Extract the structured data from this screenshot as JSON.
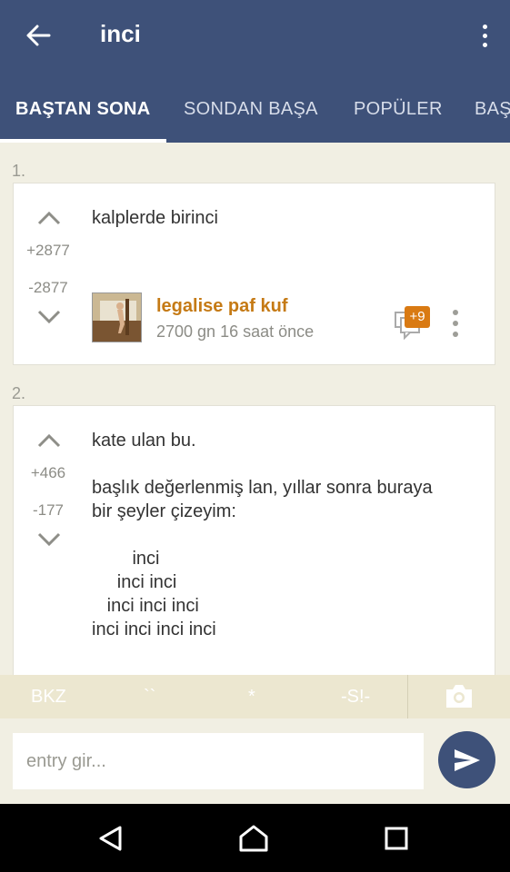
{
  "header": {
    "title": "inci",
    "back_icon": "arrow-left-icon",
    "more_icon": "more-vertical-icon"
  },
  "tabs": [
    {
      "label": "BAŞTAN SONA",
      "active": true
    },
    {
      "label": "SONDAN BAŞA",
      "active": false
    },
    {
      "label": "POPÜLER",
      "active": false
    },
    {
      "label": "BAŞ",
      "active": false
    }
  ],
  "entries": [
    {
      "number": "1.",
      "text": "kalplerde birinci",
      "upvotes": "+2877",
      "downvotes": "-2877",
      "author": "legalise paf kuf",
      "time": "2700 gn 16 saat  önce",
      "fav_badge": "+9"
    },
    {
      "number": "2.",
      "text": "kate ulan bu.\n\nbaşlık değerlenmiş lan, yıllar sonra buraya\nbir şeyler çizeyim:\n\n        inci\n     inci inci\n   inci inci inci\ninci inci inci inci",
      "upvotes": "+466",
      "downvotes": "-177"
    }
  ],
  "toolbar": {
    "bkz": "BKZ",
    "backticks": "``",
    "asterisk": "*",
    "spoiler": "-S!-",
    "camera_icon": "camera-icon"
  },
  "input": {
    "placeholder": "entry gir...",
    "send_icon": "send-icon"
  },
  "colors": {
    "appbar": "#3e5179",
    "background": "#f1efe3",
    "author": "#c57a15",
    "badge": "#d97a13"
  }
}
